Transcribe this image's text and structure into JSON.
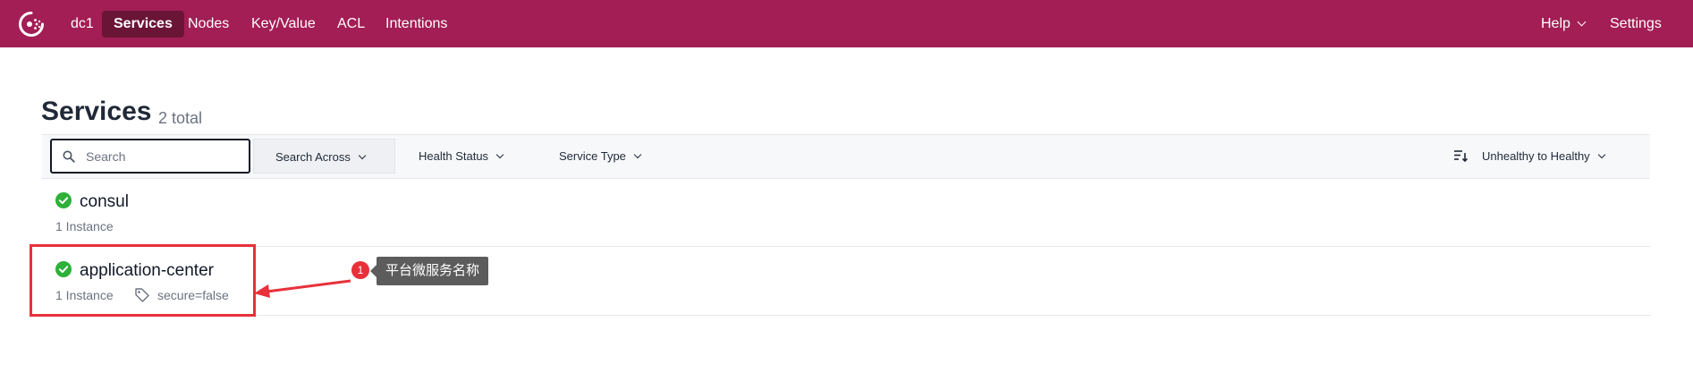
{
  "nav": {
    "datacenter": "dc1",
    "items": [
      {
        "label": "Services",
        "active": true
      },
      {
        "label": "Nodes",
        "active": false
      },
      {
        "label": "Key/Value",
        "active": false
      },
      {
        "label": "ACL",
        "active": false
      },
      {
        "label": "Intentions",
        "active": false
      }
    ],
    "help": "Help",
    "settings": "Settings",
    "brand_color": "#a21e55",
    "active_color": "#6b1536"
  },
  "page": {
    "title": "Services",
    "count": "2 total"
  },
  "filters": {
    "search_placeholder": "Search",
    "search_across": "Search Across",
    "health_status": "Health Status",
    "service_type": "Service Type",
    "sort": "Unhealthy to Healthy"
  },
  "services": [
    {
      "name": "consul",
      "instances": "1 Instance",
      "tags": [],
      "health": "passing"
    },
    {
      "name": "application-center",
      "instances": "1 Instance",
      "tags": [
        "secure=false"
      ],
      "health": "passing"
    }
  ],
  "annotation": {
    "badge": "1",
    "label": "平台微服务名称",
    "color": "#e8303a"
  },
  "icons": {
    "logo": "consul-logo-icon",
    "search": "search-icon",
    "sort": "sort-icon",
    "health": "check-circle-icon",
    "tag": "tag-icon"
  }
}
